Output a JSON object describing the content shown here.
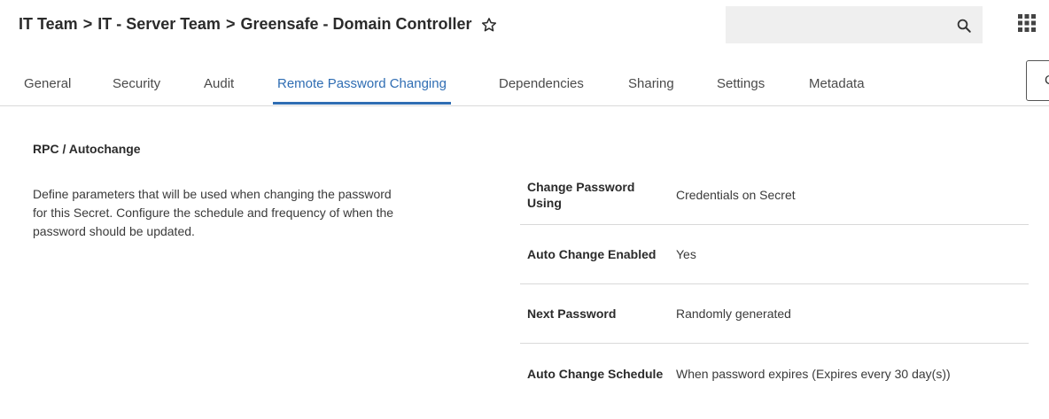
{
  "breadcrumb": {
    "items": [
      "IT Team",
      "IT - Server Team",
      "Greensafe - Domain Controller"
    ],
    "separator": ">"
  },
  "search": {
    "placeholder": "",
    "value": ""
  },
  "icons": {
    "favorite": "star-outline-icon",
    "search": "search-icon",
    "apps": "apps-grid-icon"
  },
  "tabs": [
    {
      "label": "General"
    },
    {
      "label": "Security"
    },
    {
      "label": "Audit"
    },
    {
      "label": "Remote Password Changing",
      "active": true
    },
    {
      "label": "Dependencies"
    },
    {
      "label": "Sharing"
    },
    {
      "label": "Settings"
    },
    {
      "label": "Metadata"
    }
  ],
  "corner_button": {
    "label": "C"
  },
  "section": {
    "title": "RPC / Autochange",
    "description": "Define parameters that will be used when changing the password for this Secret. Configure the schedule and frequency of when the password should be updated."
  },
  "properties": [
    {
      "label": "Change Password Using",
      "value": "Credentials on Secret"
    },
    {
      "label": "Auto Change Enabled",
      "value": "Yes"
    },
    {
      "label": "Next Password",
      "value": "Randomly generated"
    },
    {
      "label": "Auto Change Schedule",
      "value": "When password expires (Expires every 30 day(s))"
    }
  ],
  "colors": {
    "accent": "#2f6db3",
    "divider": "#d9d9d9",
    "search_bg": "#efefef"
  }
}
